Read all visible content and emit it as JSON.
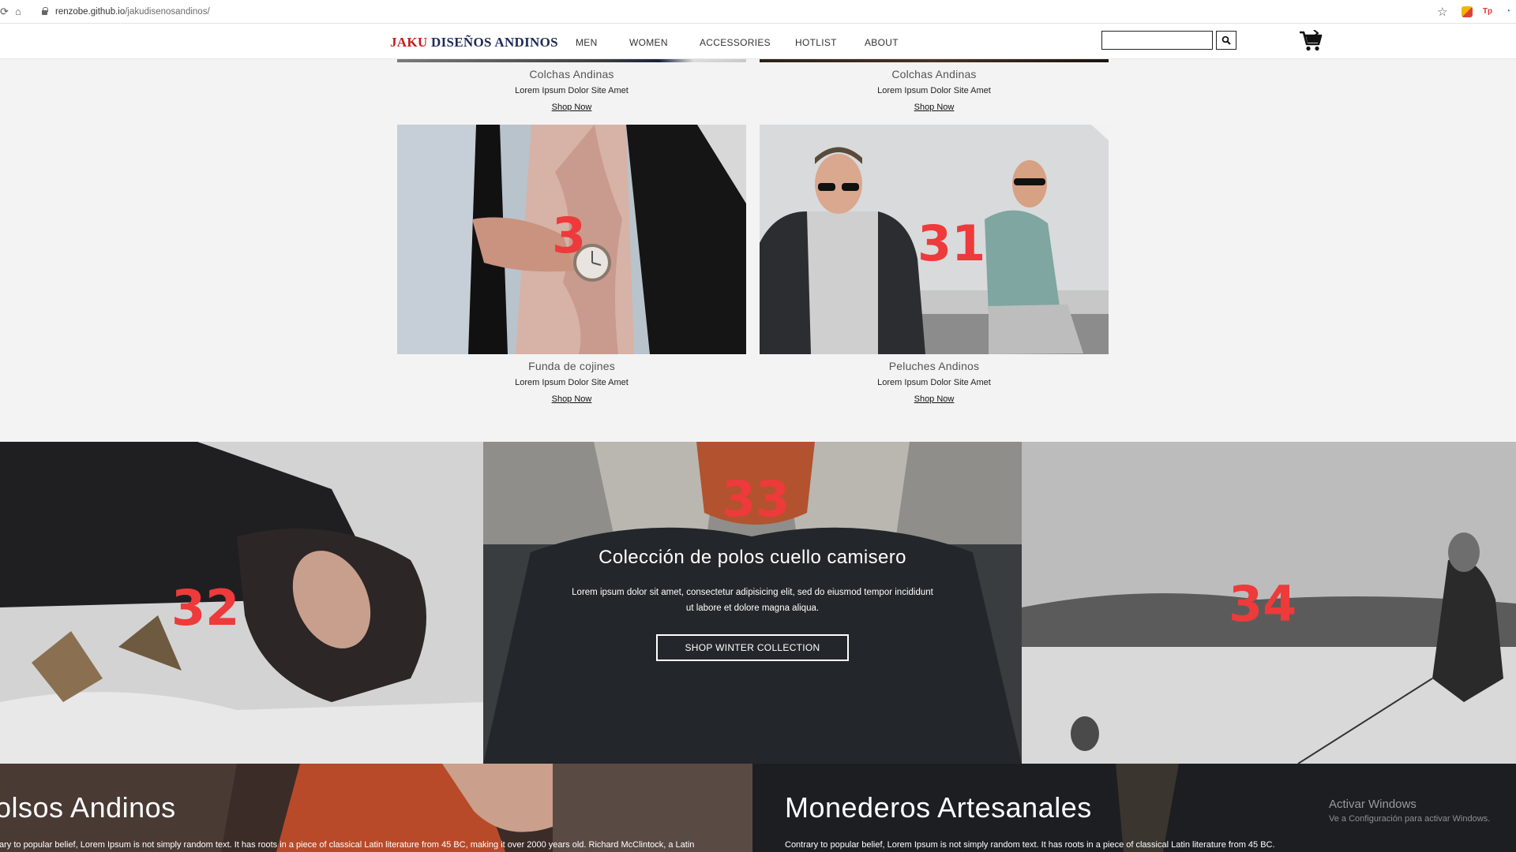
{
  "browser": {
    "url_host": "renzobe.github.io",
    "url_path": "/jakudisenosandinos/",
    "extensions": [
      "Tp"
    ]
  },
  "header": {
    "brand_accent": "JAKU",
    "brand_rest": " DISEÑOS ANDINOS",
    "nav": [
      "MEN",
      "WOMEN",
      "ACCESSORIES",
      "HOTLIST",
      "ABOUT"
    ],
    "search_value": "",
    "colors": {
      "brand_accent": "#c21d1d",
      "brand": "#1e2a55"
    }
  },
  "products": [
    {
      "title": "Colchas Andinas",
      "desc": "Lorem Ipsum Dolor Site Amet",
      "link": "Shop Now"
    },
    {
      "title": "Colchas Andinas",
      "desc": "Lorem Ipsum Dolor Site Amet",
      "link": "Shop Now"
    },
    {
      "title": "Funda de cojines",
      "desc": "Lorem Ipsum Dolor Site Amet",
      "link": "Shop Now",
      "overlay": "3"
    },
    {
      "title": "Peluches Andinos",
      "desc": "Lorem Ipsum Dolor Site Amet",
      "link": "Shop Now",
      "overlay": "31"
    }
  ],
  "banner": {
    "left_overlay": "32",
    "center_overlay": "33",
    "right_overlay": "34",
    "headline": "Colección de polos cuello camisero",
    "text_line1": "Lorem ipsum dolor sit amet, consectetur adipisicing elit, sed do eiusmod tempor incididunt",
    "text_line2": "ut labore et dolore magna aliqua.",
    "button": "SHOP WINTER COLLECTION"
  },
  "bottom": {
    "left_title": "olsos Andinos",
    "left_text": "ary to popular belief, Lorem Ipsum is not simply random text. It has roots in a piece of classical Latin literature from 45 BC, making it over 2000 years old. Richard McClintock, a Latin",
    "right_title": "Monederos Artesanales",
    "right_text": "Contrary to popular belief, Lorem Ipsum is not simply random text. It has roots in a piece of classical Latin literature from 45 BC."
  },
  "windows_watermark": {
    "title": "Activar Windows",
    "subtitle": "Ve a Configuración para activar Windows."
  }
}
